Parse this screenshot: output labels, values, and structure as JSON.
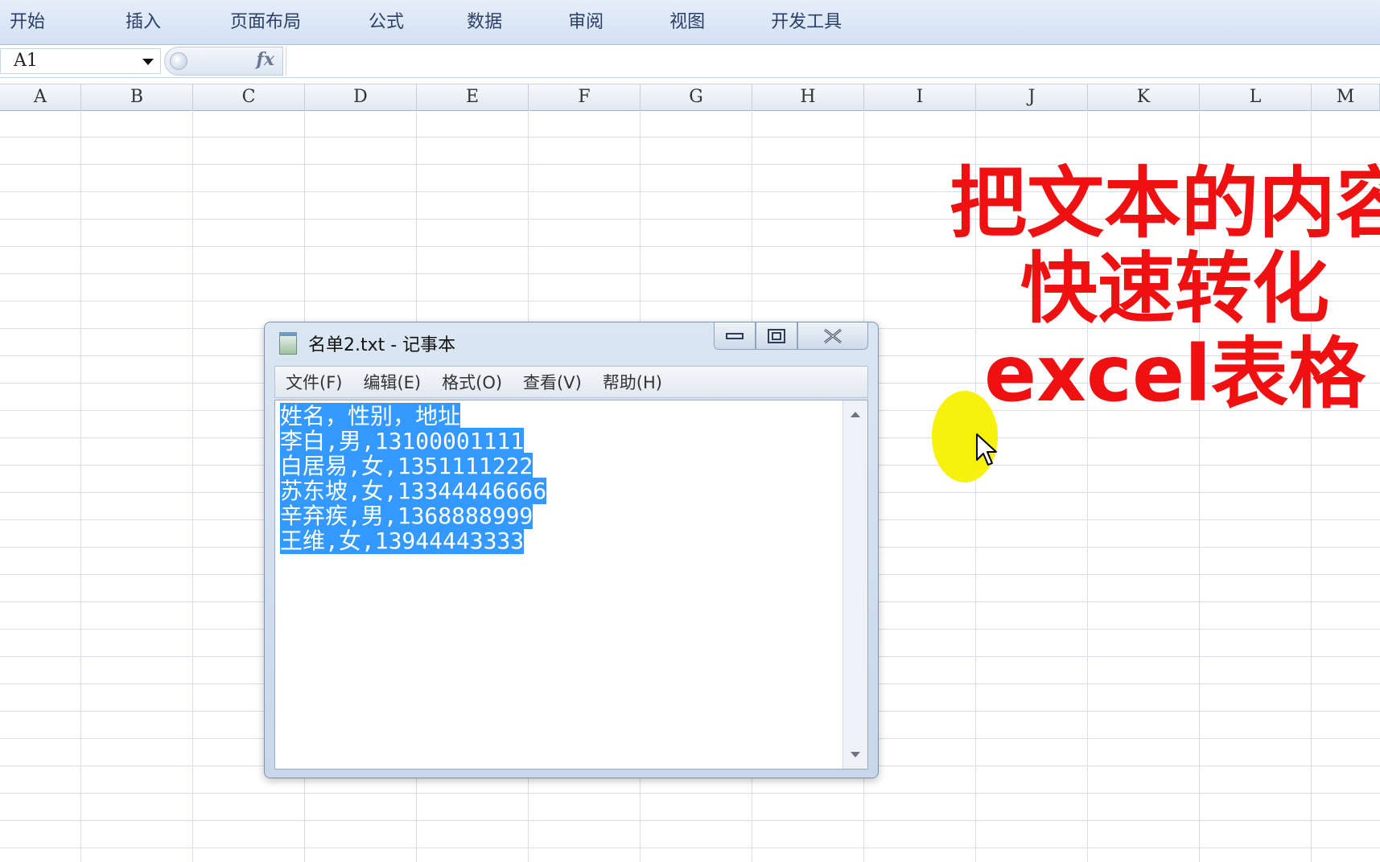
{
  "ribbon": {
    "tabs": [
      "开始",
      "插入",
      "页面布局",
      "公式",
      "数据",
      "审阅",
      "视图",
      "开发工具"
    ]
  },
  "formula_bar": {
    "name_box": "A1",
    "fx_label": "fx",
    "formula": ""
  },
  "columns": [
    "A",
    "B",
    "C",
    "D",
    "E",
    "F",
    "G",
    "H",
    "I",
    "J",
    "K",
    "L",
    "M"
  ],
  "overlay": {
    "line1": "把文本的内容",
    "line2": "快速转化",
    "line3": "excel表格",
    "color": "#ef1111"
  },
  "notepad": {
    "title": "名单2.txt - 记事本",
    "menu": [
      "文件(F)",
      "编辑(E)",
      "格式(O)",
      "查看(V)",
      "帮助(H)"
    ],
    "lines": [
      "姓名，性别，地址",
      "李白,男,13100001111",
      "白居易,女,1351111222",
      "苏东坡,女,13344446666",
      "辛弃疾,男,1368888999",
      "王维,女,13944443333"
    ],
    "selection_color": "#3399ff"
  }
}
